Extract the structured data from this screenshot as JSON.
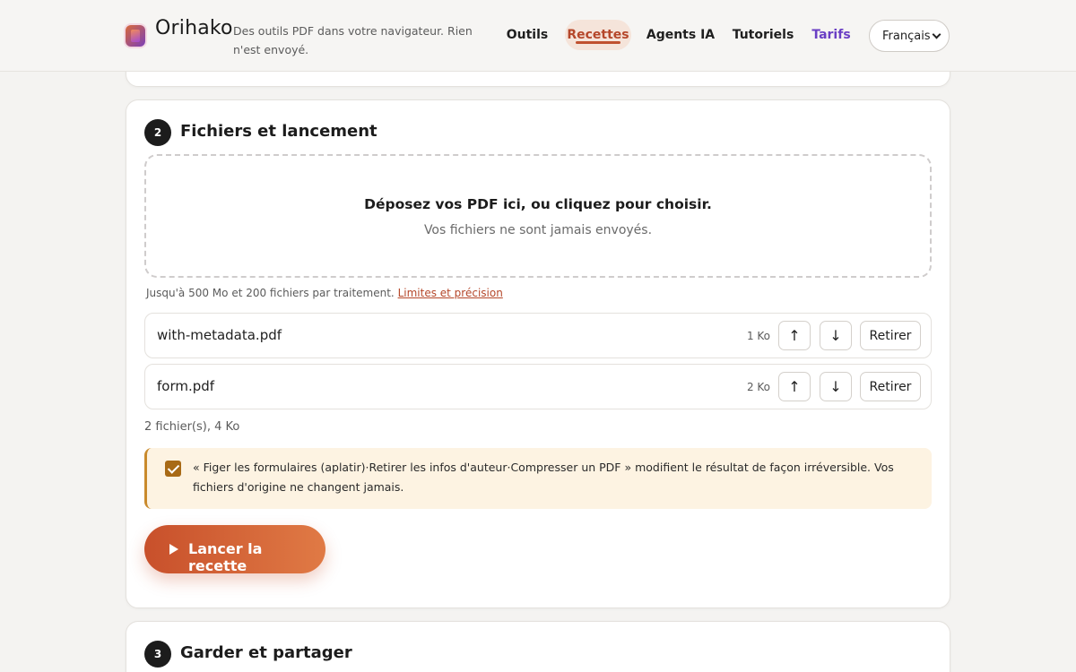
{
  "header": {
    "brand": "Orihako",
    "tagline": "Des outils PDF dans votre navigateur. Rien n'est envoyé.",
    "nav": [
      {
        "label": "Outils"
      },
      {
        "label": "Recettes"
      },
      {
        "label": "Agents IA"
      },
      {
        "label": "Tutoriels"
      },
      {
        "label": "Tarifs"
      }
    ],
    "language": "Français"
  },
  "step2": {
    "number": "2",
    "title": "Fichiers et lancement",
    "dropzone": {
      "title": "Déposez vos PDF ici, ou cliquez pour choisir.",
      "subtitle": "Vos fichiers ne sont jamais envoyés."
    },
    "limits_text": "Jusqu'à 500 Mo et 200 fichiers par traitement.",
    "limits_link": "Limites et précision",
    "files": [
      {
        "name": "with-metadata.pdf",
        "size": "1 Ko"
      },
      {
        "name": "form.pdf",
        "size": "2 Ko"
      }
    ],
    "move_up": "↑",
    "move_down": "↓",
    "remove_label": "Retirer",
    "summary": "2 fichier(s), 4 Ko",
    "warning": "« Figer les formulaires (aplatir)·Retirer les infos d'auteur·Compresser un PDF » modifient le résultat de façon irréversible. Vos fichiers d'origine ne changent jamais.",
    "warning_checked": true,
    "run_label": "Lancer la recette"
  },
  "step3": {
    "number": "3",
    "title": "Garder et partager"
  },
  "colors": {
    "accent": "#c0512f",
    "nav_active_bg": "#f5e4da",
    "tarifs": "#6a3fc4",
    "warning_bg": "#fdf3e2",
    "warning_border": "#c98a2c"
  }
}
